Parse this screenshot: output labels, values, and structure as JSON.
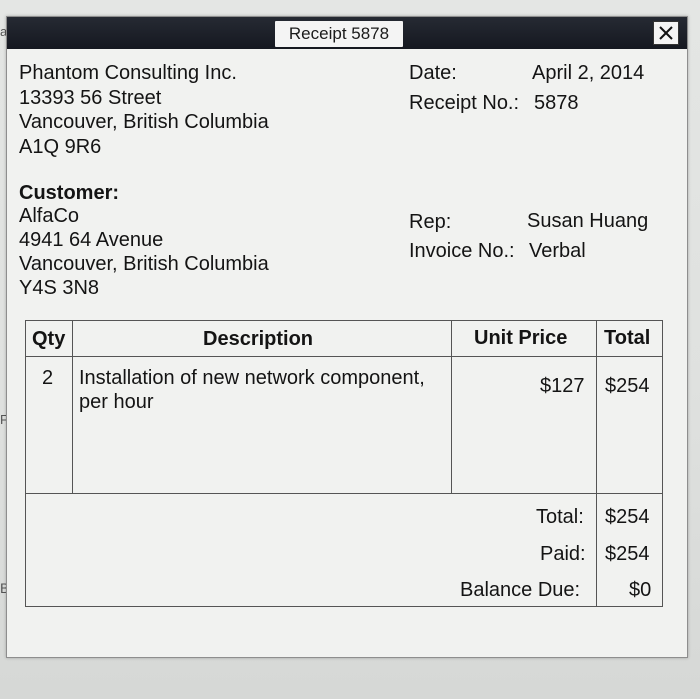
{
  "window": {
    "title": "Receipt 5878",
    "close_glyph": "✕"
  },
  "edge_marks": [
    "a",
    "Fi",
    "B"
  ],
  "company": {
    "name": "Phantom Consulting Inc.",
    "street": "13393 56 Street",
    "city": "Vancouver, British Columbia",
    "postal": "A1Q 9R6"
  },
  "meta": {
    "date_label": "Date:",
    "date_value": "April 2, 2014",
    "receipt_label": "Receipt No.:",
    "receipt_value": "5878"
  },
  "customer": {
    "heading": "Customer:",
    "name": "AlfaCo",
    "street": "4941 64 Avenue",
    "city": "Vancouver, British Columbia",
    "postal": "Y4S 3N8"
  },
  "rep": {
    "rep_label": "Rep:",
    "rep_value": "Susan Huang",
    "invoice_label": "Invoice No.:",
    "invoice_value": "Verbal"
  },
  "table": {
    "headers": {
      "qty": "Qty",
      "description": "Description",
      "unit_price": "Unit Price",
      "total": "Total"
    },
    "rows": [
      {
        "qty": "2",
        "description_line1": "Installation of new network component,",
        "description_line2": "per hour",
        "unit_price": "$127",
        "total": "$254"
      }
    ]
  },
  "summary": {
    "total_label": "Total:",
    "total_value": "$254",
    "paid_label": "Paid:",
    "paid_value": "$254",
    "balance_label": "Balance Due:",
    "balance_value": "$0"
  }
}
